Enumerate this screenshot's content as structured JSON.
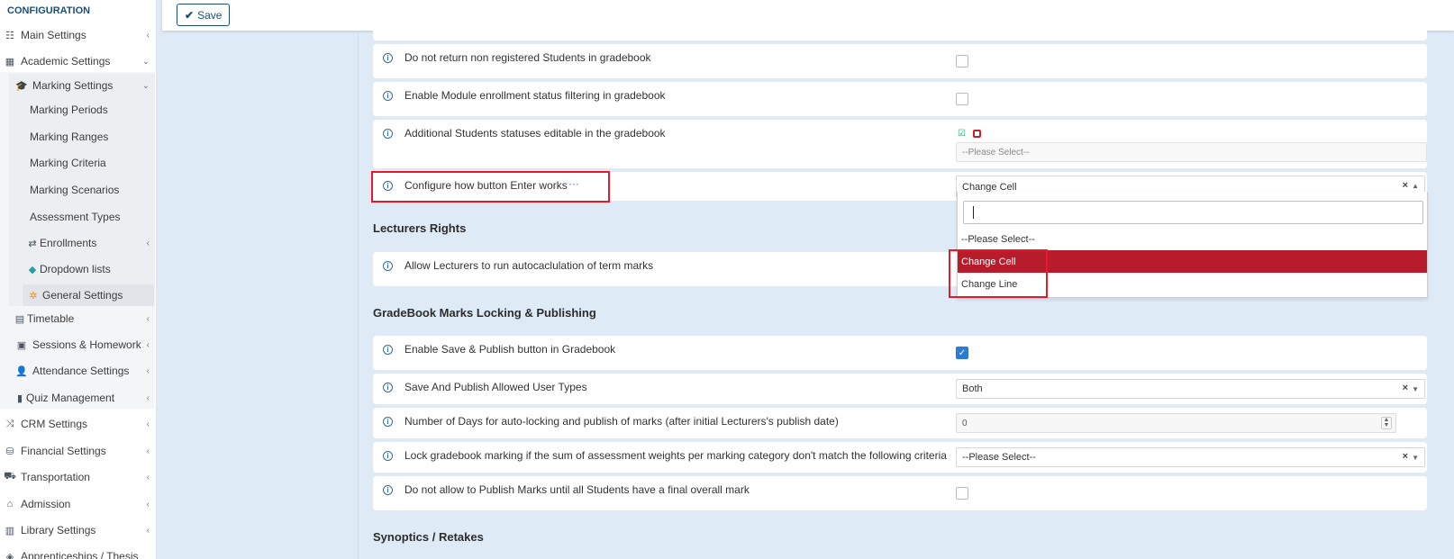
{
  "sidebar": {
    "title": "CONFIGURATION",
    "items": [
      {
        "label": "Main Settings",
        "arrow": "‹"
      },
      {
        "label": "Academic Settings",
        "arrow": "⌄"
      },
      {
        "label": "Marking Settings",
        "arrow": "⌄"
      },
      {
        "label": "Marking Periods"
      },
      {
        "label": "Marking Ranges"
      },
      {
        "label": "Marking Criteria"
      },
      {
        "label": "Marking Scenarios"
      },
      {
        "label": "Assessment Types"
      },
      {
        "label": "Enrollments",
        "arrow": "‹"
      },
      {
        "label": "Dropdown lists"
      },
      {
        "label": "General Settings"
      },
      {
        "label": "Timetable",
        "arrow": "‹"
      },
      {
        "label": "Sessions & Homework",
        "arrow": "‹"
      },
      {
        "label": "Attendance Settings",
        "arrow": "‹"
      },
      {
        "label": "Quiz Management",
        "arrow": "‹"
      },
      {
        "label": "CRM Settings",
        "arrow": "‹"
      },
      {
        "label": "Financial Settings",
        "arrow": "‹"
      },
      {
        "label": "Transportation",
        "arrow": "‹"
      },
      {
        "label": "Admission",
        "arrow": "‹"
      },
      {
        "label": "Library Settings",
        "arrow": "‹"
      },
      {
        "label": "Apprenticeships / Thesis",
        "arrow": ""
      }
    ]
  },
  "toolbar": {
    "save_label": "Save"
  },
  "settings": {
    "nonreg": "Do not return non registered Students in gradebook",
    "module_enroll": "Enable Module enrollment status filtering in gradebook",
    "additional_statuses": "Additional Students statuses editable in the gradebook",
    "additional_placeholder": "--Please Select--",
    "enter_btn": "Configure how button Enter works",
    "enter_more": "···",
    "enter_value": "Change Cell",
    "section_lecturers": "Lecturers Rights",
    "autocalc": "Allow Lecturers to run autocaclulation of term marks",
    "section_gradebook": "GradeBook Marks Locking & Publishing",
    "save_publish": "Enable Save & Publish button in Gradebook",
    "user_types": "Save And Publish Allowed User Types",
    "user_types_value": "Both",
    "days_lock": "Number of Days for auto-locking and publish of marks (after initial Lecturers's publish date)",
    "days_value": "0",
    "lock_weights": "Lock gradebook marking if the sum of assessment weights per marking category don't match the following criteria",
    "lock_weights_value": "--Please Select--",
    "no_publish": "Do not allow to Publish Marks until all Students have a final overall mark",
    "section_synoptics": "Synoptics / Retakes"
  },
  "dropdown": {
    "options": [
      "--Please Select--",
      "Change Cell",
      "Change Line"
    ],
    "highlighted": "Change Cell"
  },
  "colors": {
    "highlight": "#b71c2c",
    "annotation": "#e51a2a",
    "brand": "#1a4f7c"
  }
}
